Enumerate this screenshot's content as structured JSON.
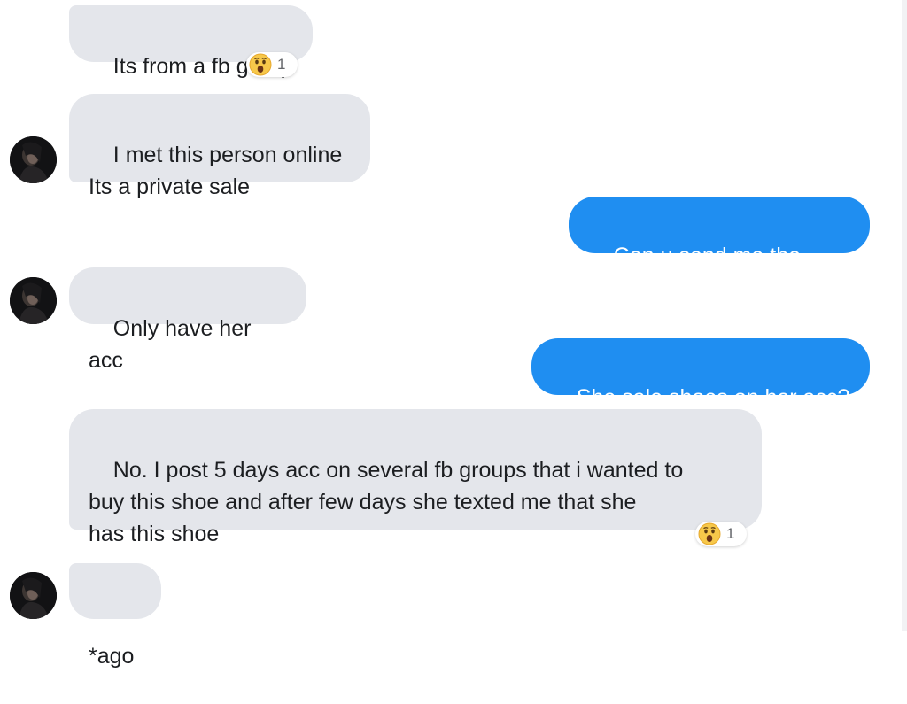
{
  "messages": [
    {
      "text": "Its from a fb group",
      "reaction": {
        "icon": "wow-emoji",
        "count": "1"
      }
    },
    {
      "text": "I met this person online\nIts a private sale"
    },
    {
      "text": "Can u send me the link?"
    },
    {
      "text": "Only have her acc"
    },
    {
      "text": "She sale shoes on her acc?"
    },
    {
      "text": "No. I post 5 days acc on several fb groups that i wanted to\nbuy this shoe and after few days she texted me that she\nhas this shoe",
      "reaction": {
        "icon": "wow-emoji",
        "count": "1"
      }
    },
    {
      "text": "*ago"
    }
  ],
  "colors": {
    "incoming_bubble": "#e4e6eb",
    "outgoing_bubble": "#1f8ef1",
    "reaction_emoji": "#f7c84a"
  }
}
